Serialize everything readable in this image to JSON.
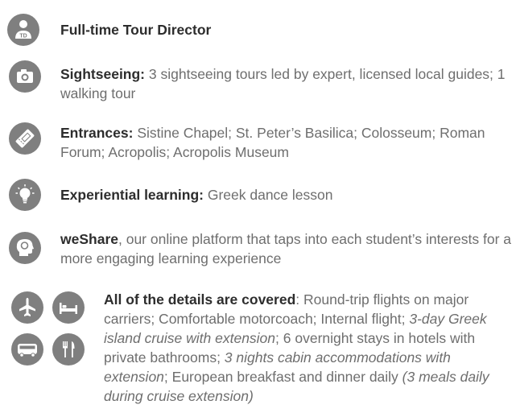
{
  "items": [
    {
      "icon": "tour-director-icon",
      "label": "Full-time Tour Director",
      "text": ""
    },
    {
      "icon": "camera-icon",
      "label": "Sightseeing:",
      "text": " 3 sightseeing tours led by expert, licensed local guides; 1 walking tour"
    },
    {
      "icon": "ticket-icon",
      "label": "Entrances:",
      "text": " Sistine Chapel; St. Peter’s Basilica; Colosseum; Roman Forum; Acropolis; Acropolis Museum"
    },
    {
      "icon": "lightbulb-icon",
      "label": "Experiential learning:",
      "text": " Greek dance lesson"
    },
    {
      "icon": "head-icon",
      "label": "weShare",
      "text": ", our online platform that taps into each student’s interests for a more engaging learning experience"
    }
  ],
  "details": {
    "icons": [
      "airplane-icon",
      "bed-icon",
      "bus-icon",
      "utensils-icon"
    ],
    "label": "All of the details are covered",
    "parts": [
      ": Round-trip flights on major carriers; Comfortable motorcoach; Internal flight; ",
      "3-day Greek island cruise with extension",
      "; 6 overnight stays in hotels with private bathrooms; ",
      "3 nights cabin accommodations with extension",
      "; European breakfast and dinner daily ",
      "(3 meals daily during cruise extension)"
    ]
  },
  "colors": {
    "icon_bg": "#7f7f7f",
    "label": "#2d2d2d",
    "body": "#6e6e6e"
  }
}
